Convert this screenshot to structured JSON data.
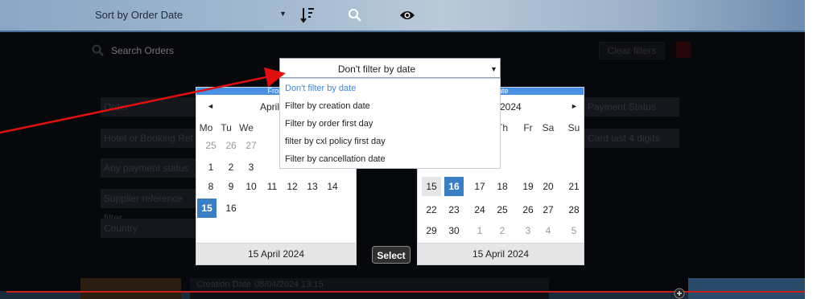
{
  "toolbar": {
    "sort_label": "Sort by Order Date"
  },
  "search": {
    "placeholder": "Search Orders"
  },
  "filters": {
    "clear_label": "Clear filters",
    "order_placeholder": "Order",
    "booking_ref_placeholder": "Hotel or Booking Ref",
    "payment_status_placeholder": "Any payment status",
    "supplier_ref_placeholder": "Supplier reference filter",
    "country_placeholder": "Country",
    "payment_status_right": "Payment Status",
    "card_last4_placeholder": "Card last 4 digits"
  },
  "date_filter": {
    "selected_label": "Don't filter by date",
    "options": [
      "Don't filter by date",
      "Filter by creation date",
      "Filter by order first day",
      "filter by cxl policy first day",
      "Filter by cancellation date"
    ]
  },
  "calendar_from": {
    "header": "From",
    "month_title": "April",
    "weekdays": [
      "Mo",
      "Tu",
      "We"
    ],
    "rows": [
      [
        "25",
        "26",
        "27"
      ],
      [
        "1",
        "2",
        "3"
      ],
      [
        "8",
        "9",
        "10",
        "11",
        "12",
        "13",
        "14"
      ],
      [
        "15",
        "16"
      ]
    ],
    "selected_day": "15",
    "footer_date": "15 April 2024"
  },
  "calendar_to": {
    "header": "Date",
    "month_title": "2024",
    "weekdays": [
      "Th",
      "Fr",
      "Sa",
      "Su"
    ],
    "rows": [
      [
        "15",
        "16",
        "17",
        "18",
        "19",
        "20",
        "21"
      ],
      [
        "22",
        "23",
        "24",
        "25",
        "26",
        "27",
        "28"
      ],
      [
        "29",
        "30",
        "1",
        "2",
        "3",
        "4",
        "5"
      ]
    ],
    "selected_day": "16",
    "footer_date": "15 April 2024"
  },
  "actions": {
    "select_label": "Select"
  },
  "order_card": {
    "creation_label": "Creation Date",
    "creation_value": "08/04/2024 13:15"
  },
  "colors": {
    "accent": "#3a7fc4",
    "header_blue": "#4a90e2",
    "annotation_red": "#e01010",
    "overlay": "#07080b"
  }
}
